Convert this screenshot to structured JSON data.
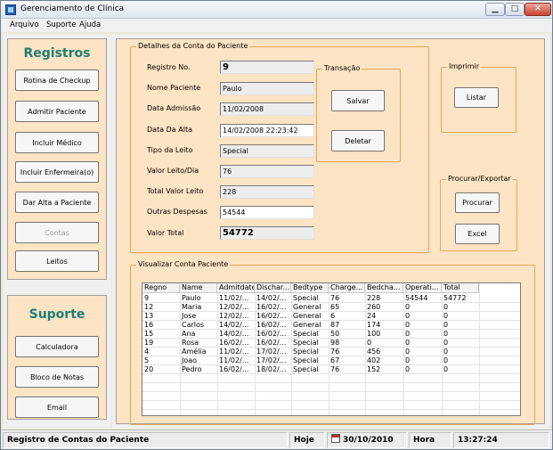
{
  "window": {
    "title": "Gerenciamento de Clínica"
  },
  "menu": [
    "Arquivo",
    "Suporte",
    "Ajuda"
  ],
  "registros": {
    "title": "Registros",
    "buttons": [
      "Rotina de Checkup",
      "Admitir Paciente",
      "Incluir Médico",
      "Incluir Enfermeira(o)",
      "Dar Alta a Paciente",
      "Contas",
      "Leitos"
    ]
  },
  "suporte": {
    "title": "Suporte",
    "buttons": [
      "Calculadora",
      "Bloco de Notas",
      "Email"
    ]
  },
  "details": {
    "legend": "Detalhes da Conta do Paciente",
    "fields": [
      {
        "label": "Registro No.",
        "value": "9"
      },
      {
        "label": "Nome Paciente",
        "value": "Paulo"
      },
      {
        "label": "Data Admissão",
        "value": "11/02/2008"
      },
      {
        "label": "Data Da Alta",
        "value": "14/02/2008 22:23:42"
      },
      {
        "label": "Tipo da Leito",
        "value": "Special"
      },
      {
        "label": "Valor Leito/Dia",
        "value": "76"
      },
      {
        "label": "Total Valor Leito",
        "value": "228"
      },
      {
        "label": "Outras Despesas",
        "value": "54544"
      },
      {
        "label": "Valor Total",
        "value": "54772"
      }
    ]
  },
  "transacao": {
    "legend": "Transação",
    "salvar": "Salvar",
    "deletar": "Deletar"
  },
  "imprimir": {
    "legend": "Imprimir",
    "listar": "Listar"
  },
  "procurar": {
    "legend": "Procurar/Exportar",
    "procurar": "Procurar",
    "excel": "Excel"
  },
  "visualizar": {
    "legend": "Visualizar Conta Paciente",
    "columns": [
      "Regno",
      "Name",
      "Admitdate",
      "Dischar...",
      "Bedtype",
      "Charge...",
      "Bedcha...",
      "Operati...",
      "Total"
    ],
    "rows": [
      [
        "9",
        "Paulo",
        "11/02/...",
        "14/02/...",
        "Special",
        "76",
        "228",
        "54544",
        "54772"
      ],
      [
        "12",
        "Maria",
        "12/02/...",
        "16/02/...",
        "General",
        "65",
        "260",
        "0",
        "0"
      ],
      [
        "13",
        "Jose",
        "12/02/...",
        "16/02/...",
        "General",
        "6",
        "24",
        "0",
        "0"
      ],
      [
        "16",
        "Carlos",
        "14/02/...",
        "16/02/...",
        "General",
        "87",
        "174",
        "0",
        "0"
      ],
      [
        "15",
        "Ana",
        "14/02/...",
        "16/02/...",
        "Special",
        "50",
        "100",
        "0",
        "0"
      ],
      [
        "19",
        "Rosa",
        "16/02/...",
        "16/02/...",
        "Special",
        "98",
        "0",
        "0",
        "0"
      ],
      [
        "4",
        "Amélia",
        "11/02/...",
        "17/02/...",
        "Special",
        "76",
        "456",
        "0",
        "0"
      ],
      [
        "5",
        "Joao",
        "11/02/...",
        "17/02/...",
        "Special",
        "67",
        "402",
        "0",
        "0"
      ],
      [
        "20",
        "Pedro",
        "16/02/...",
        "18/02/...",
        "Special",
        "76",
        "152",
        "0",
        "0"
      ]
    ]
  },
  "status": {
    "title": "Registro de Contas do Paciente",
    "hoje_label": "Hoje",
    "date": "30/10/2010",
    "hora_label": "Hora",
    "time": "13:27:24"
  }
}
